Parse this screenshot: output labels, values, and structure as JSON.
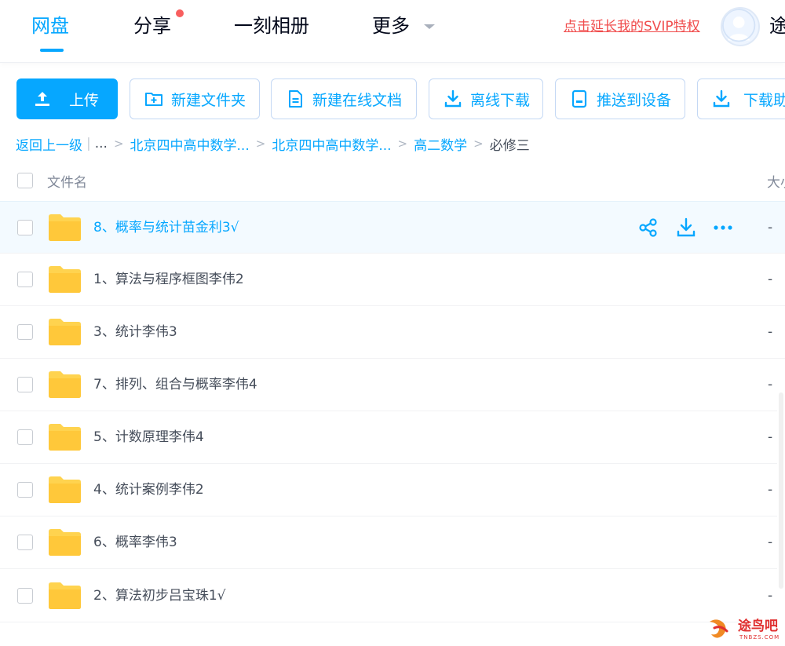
{
  "nav": {
    "tabs": [
      {
        "label": "网盘"
      },
      {
        "label": "分享"
      },
      {
        "label": "一刻相册"
      },
      {
        "label": "更多"
      }
    ],
    "svip_link": "点击延长我的SVIP特权",
    "username": "途"
  },
  "toolbar": {
    "upload": "上传",
    "new_folder": "新建文件夹",
    "new_doc": "新建在线文档",
    "offline_download": "离线下载",
    "push_device": "推送到设备",
    "download_helper": "下载助"
  },
  "breadcrumb": {
    "back": "返回上一级",
    "ellipsis": "...",
    "items": [
      "北京四中高中数学...",
      "北京四中高中数学...",
      "高二数学"
    ],
    "current": "必修三"
  },
  "table": {
    "col_name": "文件名",
    "col_size": "大小",
    "rows": [
      {
        "name": "8、概率与统计苗金利3√",
        "size": "-"
      },
      {
        "name": "1、算法与程序框图李伟2",
        "size": "-"
      },
      {
        "name": "3、统计李伟3",
        "size": "-"
      },
      {
        "name": "7、排列、组合与概率李伟4",
        "size": "-"
      },
      {
        "name": "5、计数原理李伟4",
        "size": "-"
      },
      {
        "name": "4、统计案例李伟2",
        "size": "-"
      },
      {
        "name": "6、概率李伟3",
        "size": "-"
      },
      {
        "name": "2、算法初步吕宝珠1√",
        "size": "-"
      }
    ]
  },
  "watermark": {
    "text": "途鸟吧",
    "sub": "TNBZS.COM"
  },
  "colors": {
    "accent": "#06a7ff",
    "svip": "#f04c4c",
    "folder": "#ffd34f"
  }
}
